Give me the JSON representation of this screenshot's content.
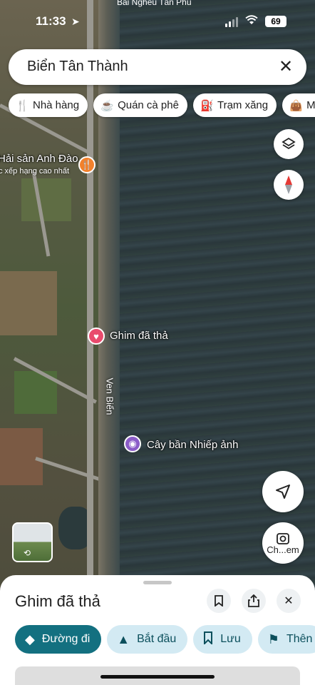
{
  "status_bar": {
    "time": "11:33",
    "battery": "69"
  },
  "top_place": "Bãi Nghêu Tân Phú",
  "search": {
    "value": "Biển Tân Thành"
  },
  "chips": [
    {
      "label": "Nhà hàng",
      "icon": "restaurant-icon"
    },
    {
      "label": "Quán cà phê",
      "icon": "coffee-icon"
    },
    {
      "label": "Trạm xăng",
      "icon": "gas-station-icon"
    },
    {
      "label": "Mu",
      "icon": "shopping-bag-icon"
    }
  ],
  "map": {
    "places": [
      {
        "label": "Hải sản Anh Đào",
        "sub": "c xếp hạng cao nhất",
        "pin_color": "#f2812c"
      },
      {
        "label": "Ghim đã thả",
        "pin_color": "#e94b6d"
      },
      {
        "label": "Cây bần Nhiếp ảnh",
        "pin_color": "#8b5cc8"
      }
    ],
    "road_label": "Ven Biển",
    "lens_label": "Ch...em"
  },
  "sheet": {
    "title": "Ghim đã thả",
    "actions": [
      {
        "label": "Đường đi",
        "icon": "directions-icon"
      },
      {
        "label": "Bắt đầu",
        "icon": "navigation-arrow-icon"
      },
      {
        "label": "Lưu",
        "icon": "bookmark-icon"
      },
      {
        "label": "Thên",
        "icon": "flag-icon"
      }
    ]
  },
  "colors": {
    "accent": "#137080",
    "chip_bg": "#d3eaf3"
  }
}
